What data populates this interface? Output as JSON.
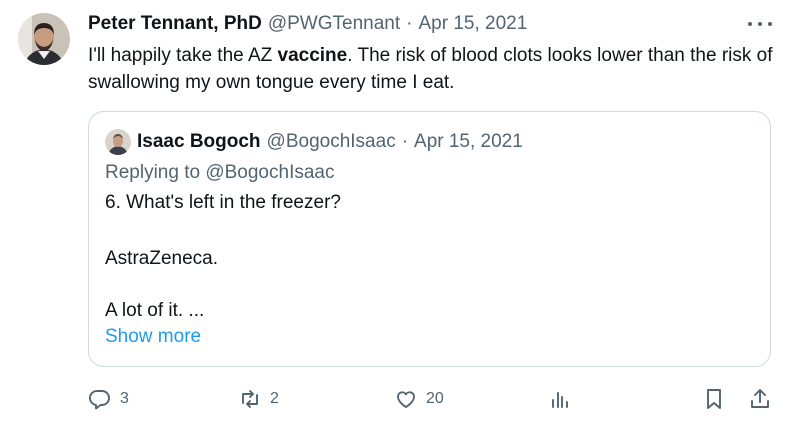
{
  "tweet": {
    "author_name": "Peter Tennant, PhD",
    "author_handle": "@PWGTennant",
    "separator": "·",
    "date": "Apr 15, 2021",
    "text_before": "I'll happily take the AZ ",
    "text_bold": "vaccine",
    "text_after": ". The risk of blood clots looks lower than the risk of swallowing my own tongue every time I eat."
  },
  "quoted": {
    "author_name": "Isaac Bogoch",
    "author_handle": "@BogochIsaac",
    "separator": "·",
    "date": "Apr 15, 2021",
    "replying_to": "Replying to @BogochIsaac",
    "lines": [
      "6. What's left in the freezer?",
      "AstraZeneca.",
      "A lot of it. ..."
    ],
    "show_more": "Show more"
  },
  "actions": {
    "reply_count": "3",
    "retweet_count": "2",
    "like_count": "20"
  },
  "colors": {
    "text_primary": "#0f1419",
    "text_secondary": "#536471",
    "link": "#1d9bf0",
    "border": "#cfd9de"
  },
  "icons": [
    "more-icon",
    "reply-icon",
    "retweet-icon",
    "like-icon",
    "views-icon",
    "bookmark-icon",
    "share-icon"
  ]
}
